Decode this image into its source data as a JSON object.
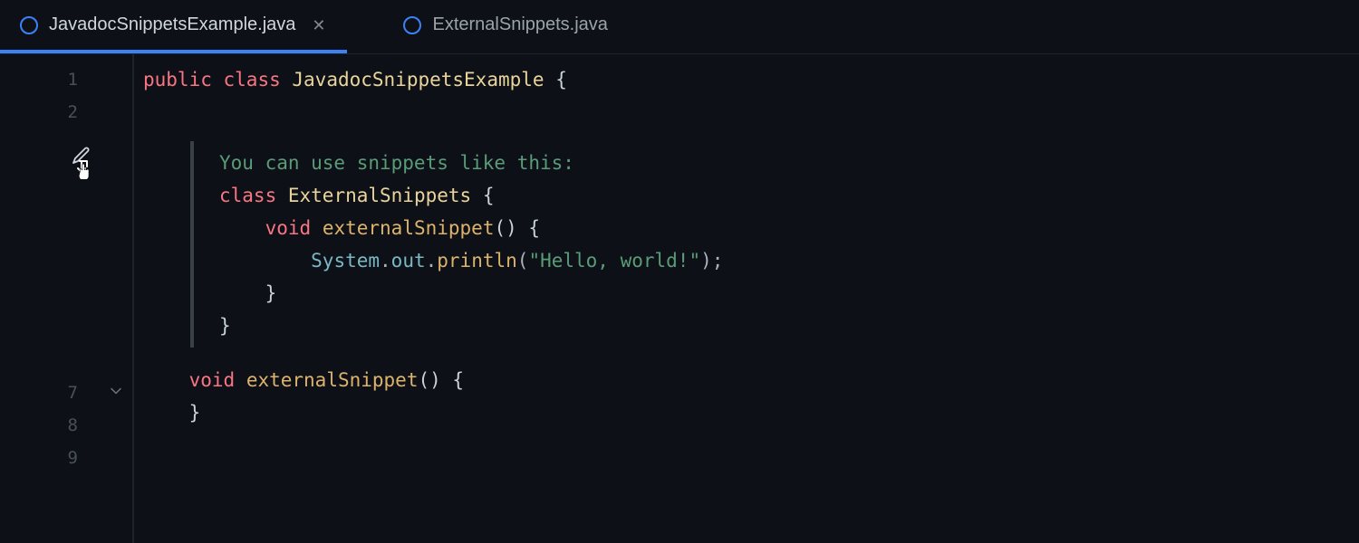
{
  "tabs": [
    {
      "label": "JavadocSnippetsExample.java",
      "active": true,
      "closable": true
    },
    {
      "label": "ExternalSnippets.java",
      "active": false,
      "closable": false
    }
  ],
  "gutter": {
    "visible": [
      "1",
      "2",
      "",
      "",
      "",
      "",
      "",
      "",
      "",
      "7",
      "8",
      "9"
    ],
    "folded_at": "7"
  },
  "code": {
    "line1": {
      "kw1": "public",
      "kw2": "class",
      "cls": "JavadocSnippetsExample",
      "brace": " {"
    },
    "javadoc": {
      "intro": "You can use snippets like this:",
      "l1": {
        "kw": "class",
        "cls": "ExternalSnippets",
        "brace": " {"
      },
      "l2": {
        "kw": "void",
        "mtd": "externalSnippet",
        "rest": "() {"
      },
      "l3": {
        "obj1": "System",
        "p1": ".",
        "obj2": "out",
        "p2": ".",
        "mtd": "println",
        "lp": "(",
        "str": "\"Hello, world!\"",
        "rp": ");"
      },
      "l4": "}",
      "l5": "}"
    },
    "line7": {
      "kw": "void",
      "mtd": "externalSnippet",
      "rest": "() {"
    },
    "line8": "}"
  }
}
